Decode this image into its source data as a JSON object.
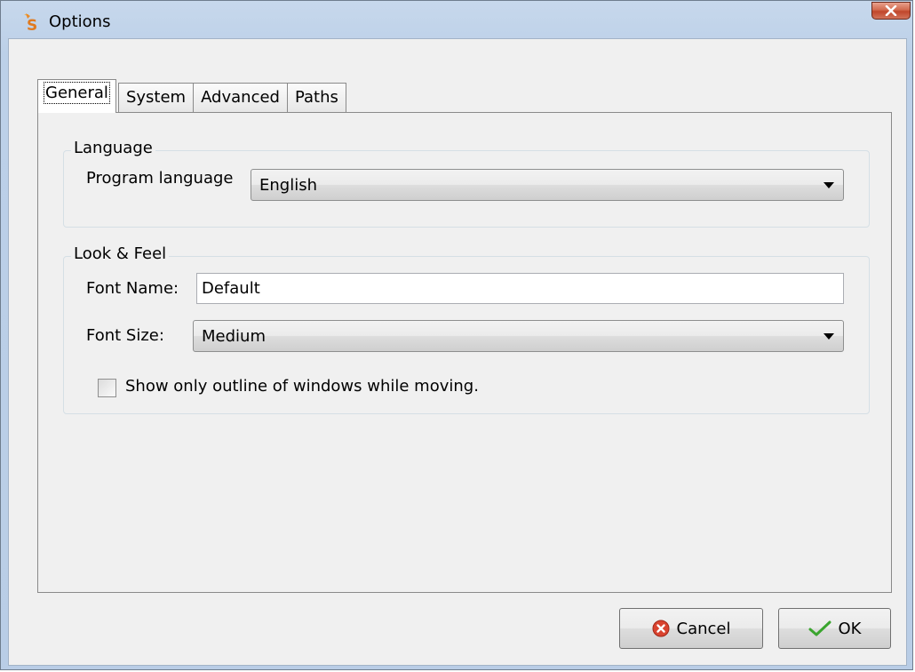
{
  "window": {
    "title": "Options",
    "close_label": "×"
  },
  "tabs": [
    {
      "label": "General",
      "active": true
    },
    {
      "label": "System",
      "active": false
    },
    {
      "label": "Advanced",
      "active": false
    },
    {
      "label": "Paths",
      "active": false
    }
  ],
  "language_group": {
    "legend": "Language",
    "program_language_label": "Program language",
    "program_language_value": "English"
  },
  "look_feel_group": {
    "legend": "Look & Feel",
    "font_name_label": "Font Name:",
    "font_name_value": "Default",
    "font_size_label": "Font Size:",
    "font_size_value": "Medium",
    "outline_checkbox_label": "Show only outline of windows while moving.",
    "outline_checkbox_checked": false
  },
  "buttons": {
    "cancel_label": "Cancel",
    "ok_label": "OK"
  },
  "colors": {
    "cancel_icon": "#d9432f",
    "ok_icon": "#3aa52e",
    "close_button": "#c7472b",
    "app_icon": "#e07a1f"
  },
  "icons": {
    "app": "app-s-icon",
    "close": "close-icon",
    "cancel": "cancel-circle-icon",
    "ok": "check-icon",
    "dropdown": "chevron-down-icon"
  }
}
